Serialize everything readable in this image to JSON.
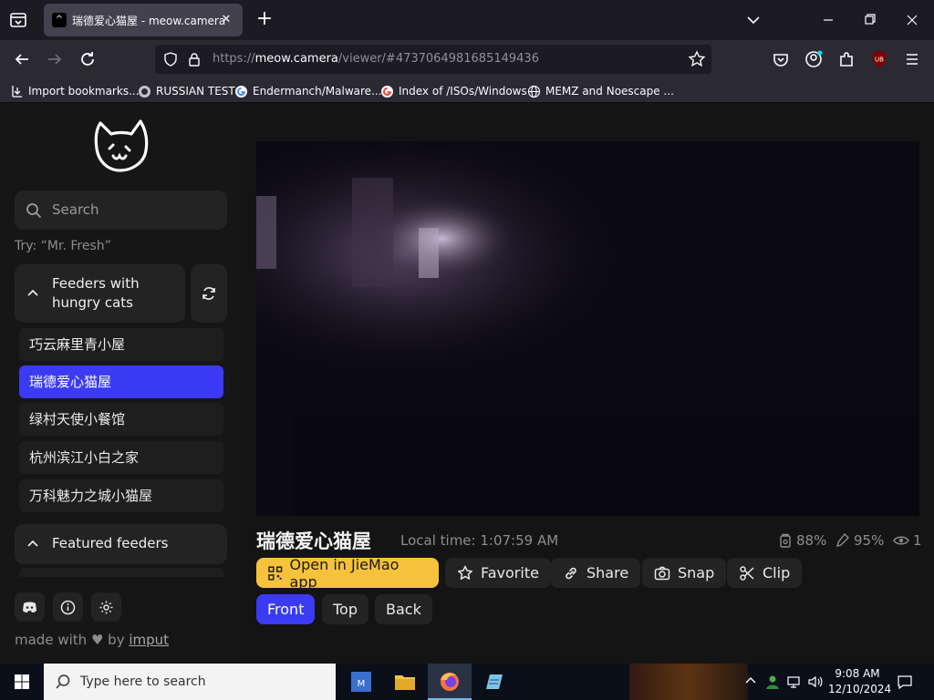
{
  "browser": {
    "tab_title": "瑞德爱心猫屋 - meow.camera",
    "url_prefix": "https://",
    "url_host": "meow.camera",
    "url_path": "/viewer/#4737064981685149436",
    "extension_badge": "UB"
  },
  "bookmarks": [
    {
      "label": "Import bookmarks...",
      "icon": "import-icon"
    },
    {
      "label": "RUSSIAN TEST",
      "icon": "github-icon"
    },
    {
      "label": "Endermanch/Malware...",
      "icon": "google-icon"
    },
    {
      "label": "Index of /ISOs/Windows",
      "icon": "google-icon"
    },
    {
      "label": "MEMZ and Noescape ...",
      "icon": "globe-icon"
    }
  ],
  "sidebar": {
    "search_placeholder": "Search",
    "try_hint": "Try: “Mr. Fresh”",
    "group_hungry_title_1": "Feeders with",
    "group_hungry_title_2": "hungry cats",
    "feeders": [
      {
        "name": "巧云麻里青小屋",
        "active": false
      },
      {
        "name": "瑞德爱心猫屋",
        "active": true
      },
      {
        "name": "绿村天使小餐馆",
        "active": false
      },
      {
        "name": "杭州滨江小白之家",
        "active": false
      },
      {
        "name": "万科魅力之城小猫屋",
        "active": false
      }
    ],
    "group_featured_title": "Featured feeders",
    "footer_prefix": "made with",
    "footer_by": "by",
    "footer_link": "imput"
  },
  "viewer": {
    "title": "瑞德爱心猫屋",
    "local_time": "Local time: 1:07:59 AM",
    "food_level": "88%",
    "water_level": "95%",
    "viewers": "1",
    "buttons": {
      "open_app": "Open in JieMao app",
      "favorite": "Favorite",
      "share": "Share",
      "snap": "Snap",
      "clip": "Clip"
    },
    "cameras": [
      "Front",
      "Top",
      "Back"
    ],
    "active_camera": "Front"
  },
  "taskbar": {
    "search_placeholder": "Type here to search",
    "time": "9:08 AM",
    "date": "12/10/2024"
  },
  "colors": {
    "accent": "#3b3bf5",
    "primary_button": "#f7c23b",
    "sidebar_bg": "#161616",
    "page_bg": "#141414"
  }
}
